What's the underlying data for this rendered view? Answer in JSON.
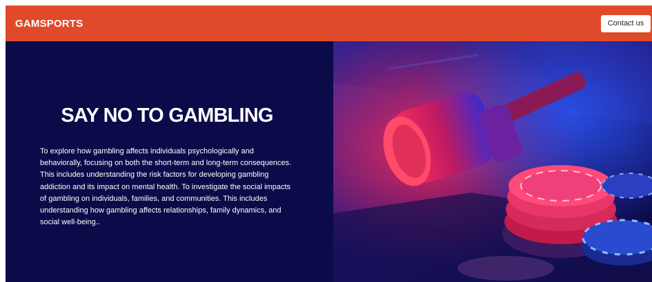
{
  "header": {
    "brand": "GAMSPORTS",
    "contact_label": "Contact us"
  },
  "hero": {
    "title": "SAY NO TO GAMBLING",
    "description": " To explore how gambling affects individuals psychologically and behaviorally, focusing on both the short-term and long-term consequences. This includes understanding the risk factors for developing gambling addiction and its impact on mental health. To investigate the social impacts of gambling on individuals, families, and communities. This includes understanding how gambling affects relationships, family dynamics, and social well-being.."
  },
  "colors": {
    "header_bg": "#df4a2b",
    "hero_bg": "#0b0b4a",
    "text": "#ffffff"
  },
  "icons": [
    "gavel-image",
    "casino-chips-image"
  ]
}
